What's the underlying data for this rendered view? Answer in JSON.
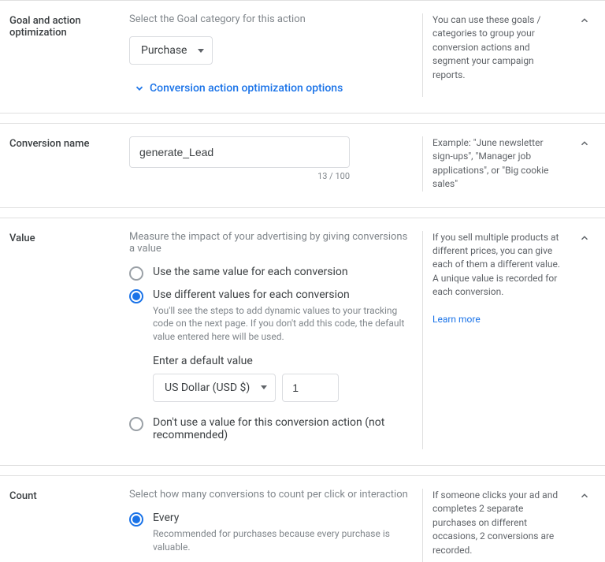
{
  "goal": {
    "title": "Goal and action optimization",
    "help": "Select the Goal category for this action",
    "select_value": "Purchase",
    "expand_link": "Conversion action optimization options",
    "side": "You can use these goals / categories to group your conversion actions and segment your campaign reports."
  },
  "name": {
    "title": "Conversion name",
    "value": "generate_Lead",
    "counter": "13 / 100",
    "side": "Example: \"June newsletter sign-ups\", \"Manager job applications\", or \"Big cookie sales\""
  },
  "value": {
    "title": "Value",
    "help": "Measure the impact of your advertising by giving conversions a value",
    "opt_same": "Use the same value for each conversion",
    "opt_diff": "Use different values for each conversion",
    "opt_diff_sub": "You'll see the steps to add dynamic values to your tracking code on the next page. If you don't add this code, the default value entered here will be used.",
    "default_label": "Enter a default value",
    "currency": "US Dollar (USD $)",
    "default_value": "1",
    "opt_none": "Don't use a value for this conversion action (not recommended)",
    "side": "If you sell multiple products at different prices, you can give each of them a different value. A unique value is recorded for each conversion.",
    "learn_more": "Learn more"
  },
  "count": {
    "title": "Count",
    "help": "Select how many conversions to count per click or interaction",
    "opt_every": "Every",
    "opt_every_sub": "Recommended for purchases because every purchase is valuable.",
    "side": "If someone clicks your ad and completes 2 separate purchases on different occasions, 2 conversions are recorded."
  }
}
